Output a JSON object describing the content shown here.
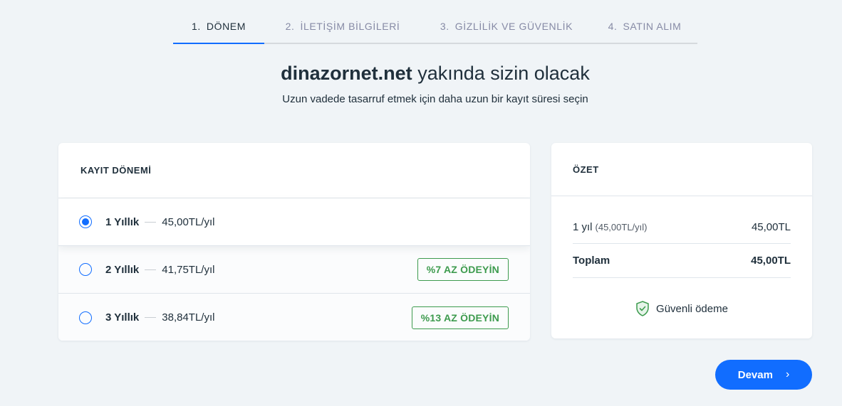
{
  "stepper": {
    "steps": [
      {
        "num": "1.",
        "label": "DÖNEM"
      },
      {
        "num": "2.",
        "label": "İLETİŞİM BİLGİLERİ"
      },
      {
        "num": "3.",
        "label": "GİZLİLİK VE GÜVENLİK"
      },
      {
        "num": "4.",
        "label": "SATIN ALIM"
      }
    ]
  },
  "headline": {
    "domain": "dinazornet.net",
    "rest": " yakında sizin olacak",
    "subtitle": "Uzun vadede tasarruf etmek için daha uzun bir kayıt süresi seçin"
  },
  "period": {
    "header": "KAYIT DÖNEMİ",
    "options": [
      {
        "label": "1 Yıllık",
        "price": "45,00TL/yıl",
        "badge": ""
      },
      {
        "label": "2 Yıllık",
        "price": "41,75TL/yıl",
        "badge": "%7 AZ ÖDEYİN"
      },
      {
        "label": "3 Yıllık",
        "price": "38,84TL/yıl",
        "badge": "%13 AZ ÖDEYİN"
      }
    ]
  },
  "summary": {
    "header": "ÖZET",
    "line_label": "1 yıl",
    "line_sub": "(45,00TL/yıl)",
    "line_value": "45,00TL",
    "total_label": "Toplam",
    "total_value": "45,00TL",
    "secure_label": "Güvenli ödeme"
  },
  "continue_button": {
    "label": "Devam"
  },
  "colors": {
    "accent": "#116dff",
    "savings": "#3d9b4e",
    "background": "#f0f4f7"
  }
}
